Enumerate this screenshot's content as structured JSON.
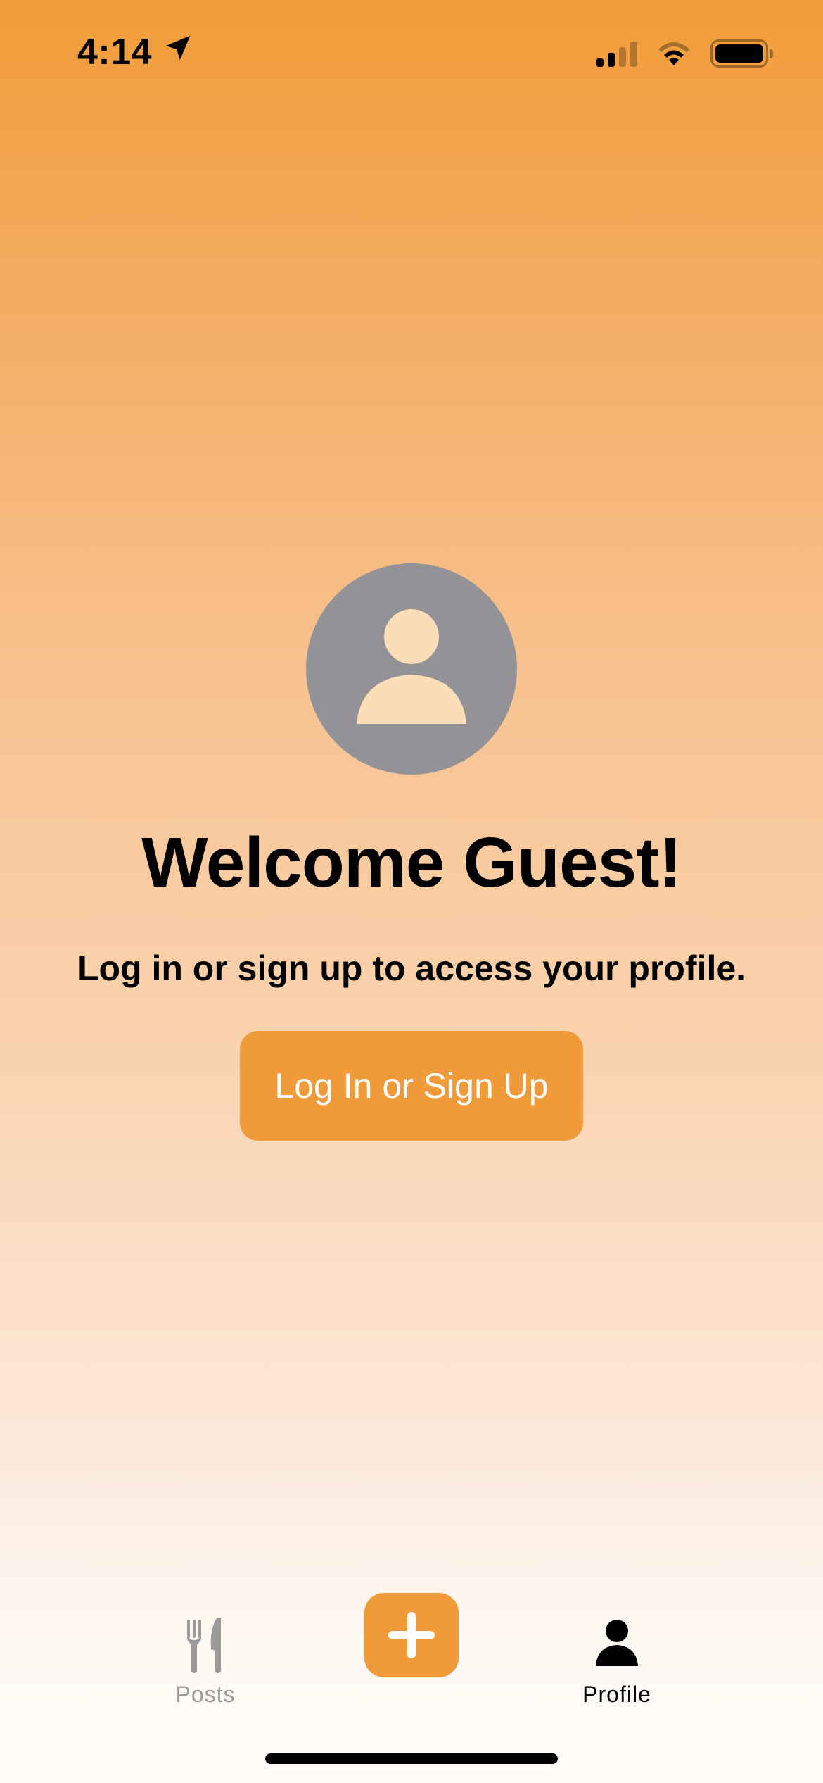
{
  "status_bar": {
    "time": "4:14",
    "icons": [
      "location-arrow-icon",
      "cellular-signal-icon",
      "wifi-icon",
      "battery-icon"
    ]
  },
  "profile": {
    "avatar_icon": "person-circle-icon",
    "title": "Welcome Guest!",
    "subtitle": "Log in or sign up to access your profile.",
    "login_button_label": "Log In or Sign Up"
  },
  "tab_bar": {
    "tabs": [
      {
        "label": "Posts",
        "icon": "fork-knife-icon",
        "selected": false
      },
      {
        "label": "Profile",
        "icon": "person-icon",
        "selected": true
      }
    ],
    "add_button_icon": "plus-icon"
  },
  "colors": {
    "accent": "#F09A39",
    "avatar_gray": "#939397",
    "tab_inactive": "#9A9A9A",
    "tab_active": "#000000"
  }
}
